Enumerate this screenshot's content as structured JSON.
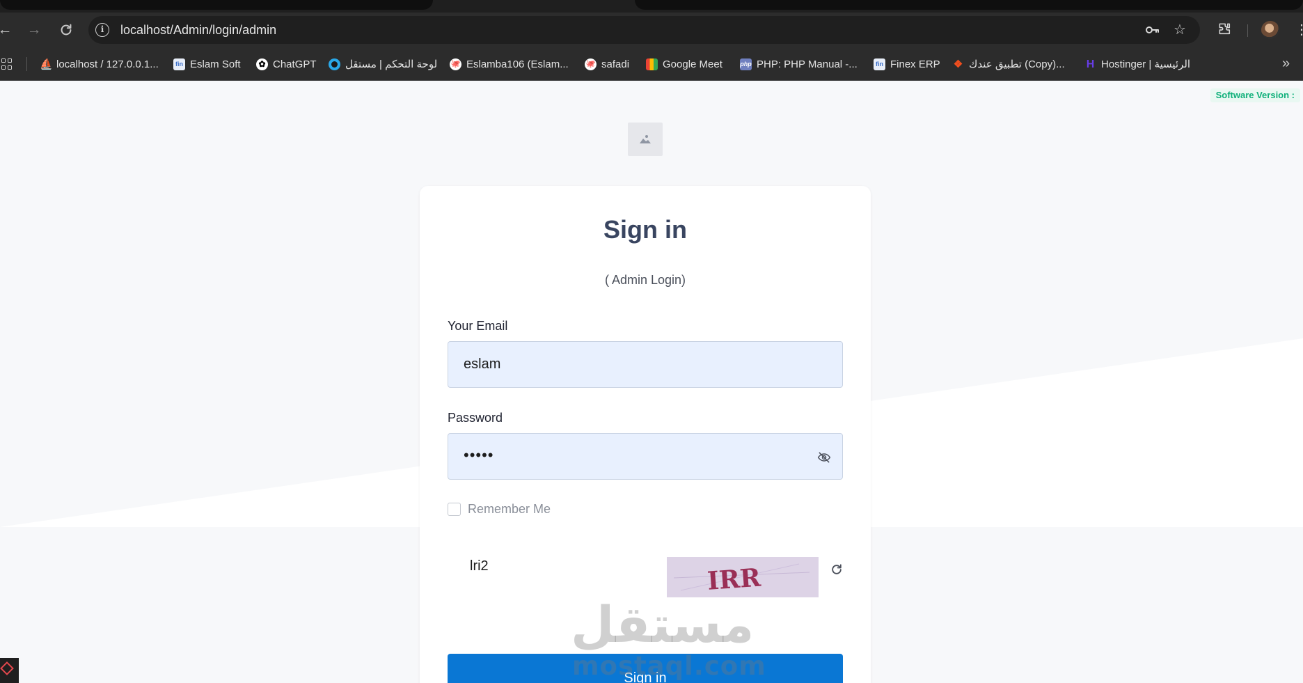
{
  "browser": {
    "url": "localhost/Admin/login/admin",
    "bookmarks": [
      {
        "label": "localhost / 127.0.0.1...",
        "icon": "phpmyadmin-icon",
        "color": "#f0a93b"
      },
      {
        "label": "Eslam Soft",
        "icon": "finex-icon",
        "color": "#3a6ec9"
      },
      {
        "label": "ChatGPT",
        "icon": "chatgpt-icon",
        "color": "#0a0a0a"
      },
      {
        "label": "لوحة التحكم | مستقل",
        "icon": "mostaql-icon",
        "color": "#2aa8e8"
      },
      {
        "label": "Eslamba106 (Eslam...",
        "icon": "github-icon",
        "color": "#0a0a0a"
      },
      {
        "label": "safadi",
        "icon": "github-icon",
        "color": "#0a0a0a"
      },
      {
        "label": "Google Meet",
        "icon": "meet-icon",
        "color": "#34a853"
      },
      {
        "label": "PHP: PHP Manual -...",
        "icon": "php-icon",
        "color": "#6f7fbf"
      },
      {
        "label": "Finex ERP",
        "icon": "finex-icon",
        "color": "#3a6ec9"
      },
      {
        "label": "تطبيق عندك (Copy)...",
        "icon": "figma-icon",
        "color": "#f24e1e"
      },
      {
        "label": "Hostinger | الرئيسية",
        "icon": "hostinger-icon",
        "color": "#673de6"
      }
    ]
  },
  "page": {
    "software_version": "Software Version :",
    "title": "Sign in",
    "subtitle": "( Admin Login)",
    "email_label": "Your Email",
    "email_value": "eslam",
    "password_label": "Password",
    "password_value": "•••••",
    "remember_label": "Remember Me",
    "captcha_value": "lri2",
    "captcha_image_text": "IRR",
    "signin_label": "Sign in",
    "primary_color": "#0a77d4"
  },
  "watermark": {
    "arabic": "مستقل",
    "latin": "mostaql.com"
  }
}
